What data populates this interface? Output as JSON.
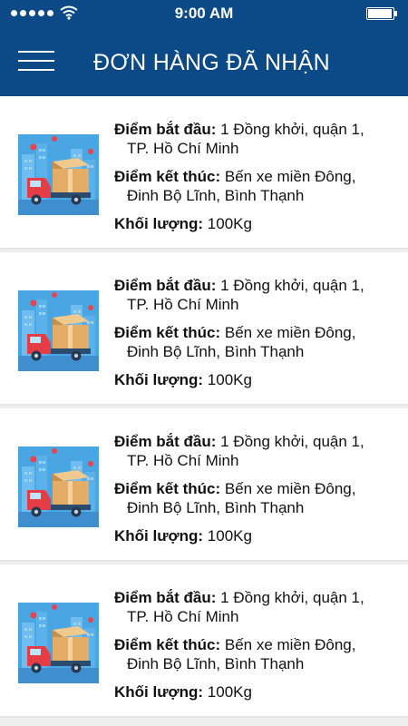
{
  "status_bar": {
    "time": "9:00 AM"
  },
  "header": {
    "title": "ĐƠN HÀNG ĐÃ NHẬN"
  },
  "orders": [
    {
      "start_label": "Điểm bắt đầu:",
      "start_line1": "1 Đồng khởi, quận 1,",
      "start_line2": "TP. Hồ Chí Minh",
      "end_label": "Điểm kết thúc:",
      "end_line1": "Bến xe miền Đông,",
      "end_line2": "Đinh Bộ Lĩnh, Bình Thạnh",
      "weight_label": "Khối lượng:",
      "weight_value": "100Kg"
    },
    {
      "start_label": "Điểm bắt đầu:",
      "start_line1": "1 Đồng khởi, quận 1,",
      "start_line2": "TP. Hồ Chí Minh",
      "end_label": "Điểm kết thúc:",
      "end_line1": "Bến xe miền Đông,",
      "end_line2": "Đinh Bộ Lĩnh, Bình Thạnh",
      "weight_label": "Khối lượng:",
      "weight_value": "100Kg"
    },
    {
      "start_label": "Điểm bắt đầu:",
      "start_line1": "1 Đồng khởi, quận 1,",
      "start_line2": "TP. Hồ Chí Minh",
      "end_label": "Điểm kết thúc:",
      "end_line1": "Bến xe miền Đông,",
      "end_line2": "Đinh Bộ Lĩnh, Bình Thạnh",
      "weight_label": "Khối lượng:",
      "weight_value": "100Kg"
    },
    {
      "start_label": "Điểm bắt đầu:",
      "start_line1": "1 Đồng khởi, quận 1,",
      "start_line2": "TP. Hồ Chí Minh",
      "end_label": "Điểm kết thúc:",
      "end_line1": "Bến xe miền Đông,",
      "end_line2": "Đinh Bộ Lĩnh, Bình Thạnh",
      "weight_label": "Khối lượng:",
      "weight_value": "100Kg"
    }
  ],
  "colors": {
    "header_bg": "#0b4a86",
    "page_bg": "#eeeeee",
    "card_bg": "#ffffff"
  },
  "icons": {
    "menu": "hamburger-menu-icon",
    "thumbnail": "delivery-truck-icon"
  }
}
